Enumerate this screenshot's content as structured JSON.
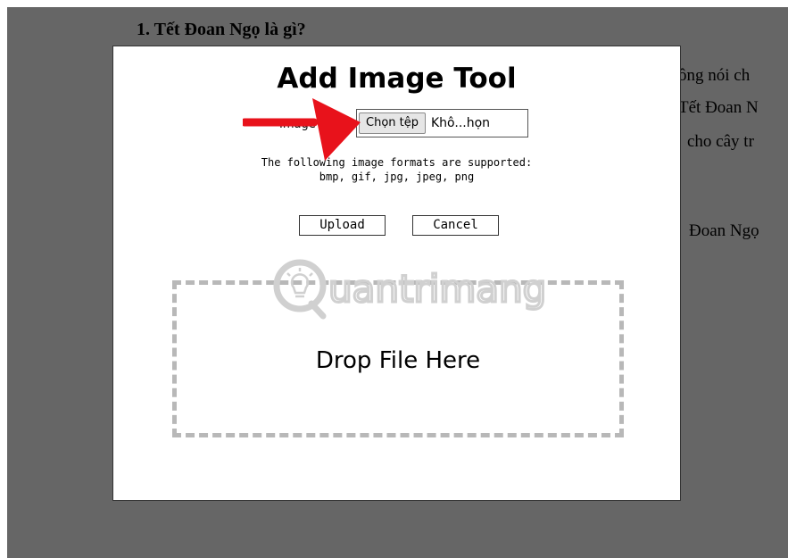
{
  "background": {
    "heading": "1. Tết Đoan Ngọ là gì?",
    "text_lines": [
      "ông nói ch",
      "Tết Đoan N",
      "cho cây tr",
      "Đoan Ngọ"
    ]
  },
  "dialog": {
    "title": "Add Image Tool",
    "file_label": "Image file:",
    "choose_button": "Chọn tệp",
    "file_name": "Khô...họn",
    "formats_line1": "The following image formats are supported:",
    "formats_line2": "bmp, gif, jpg, jpeg, png",
    "upload_label": "Upload",
    "cancel_label": "Cancel",
    "drop_label": "Drop File Here"
  },
  "overlay": {
    "arrow_color": "#e8121b",
    "watermark_text": "uantrimang",
    "watermark_color": "#d0d0d0"
  },
  "colors": {
    "backdrop": "#666666",
    "dropzone_border": "#b8b8b8"
  }
}
